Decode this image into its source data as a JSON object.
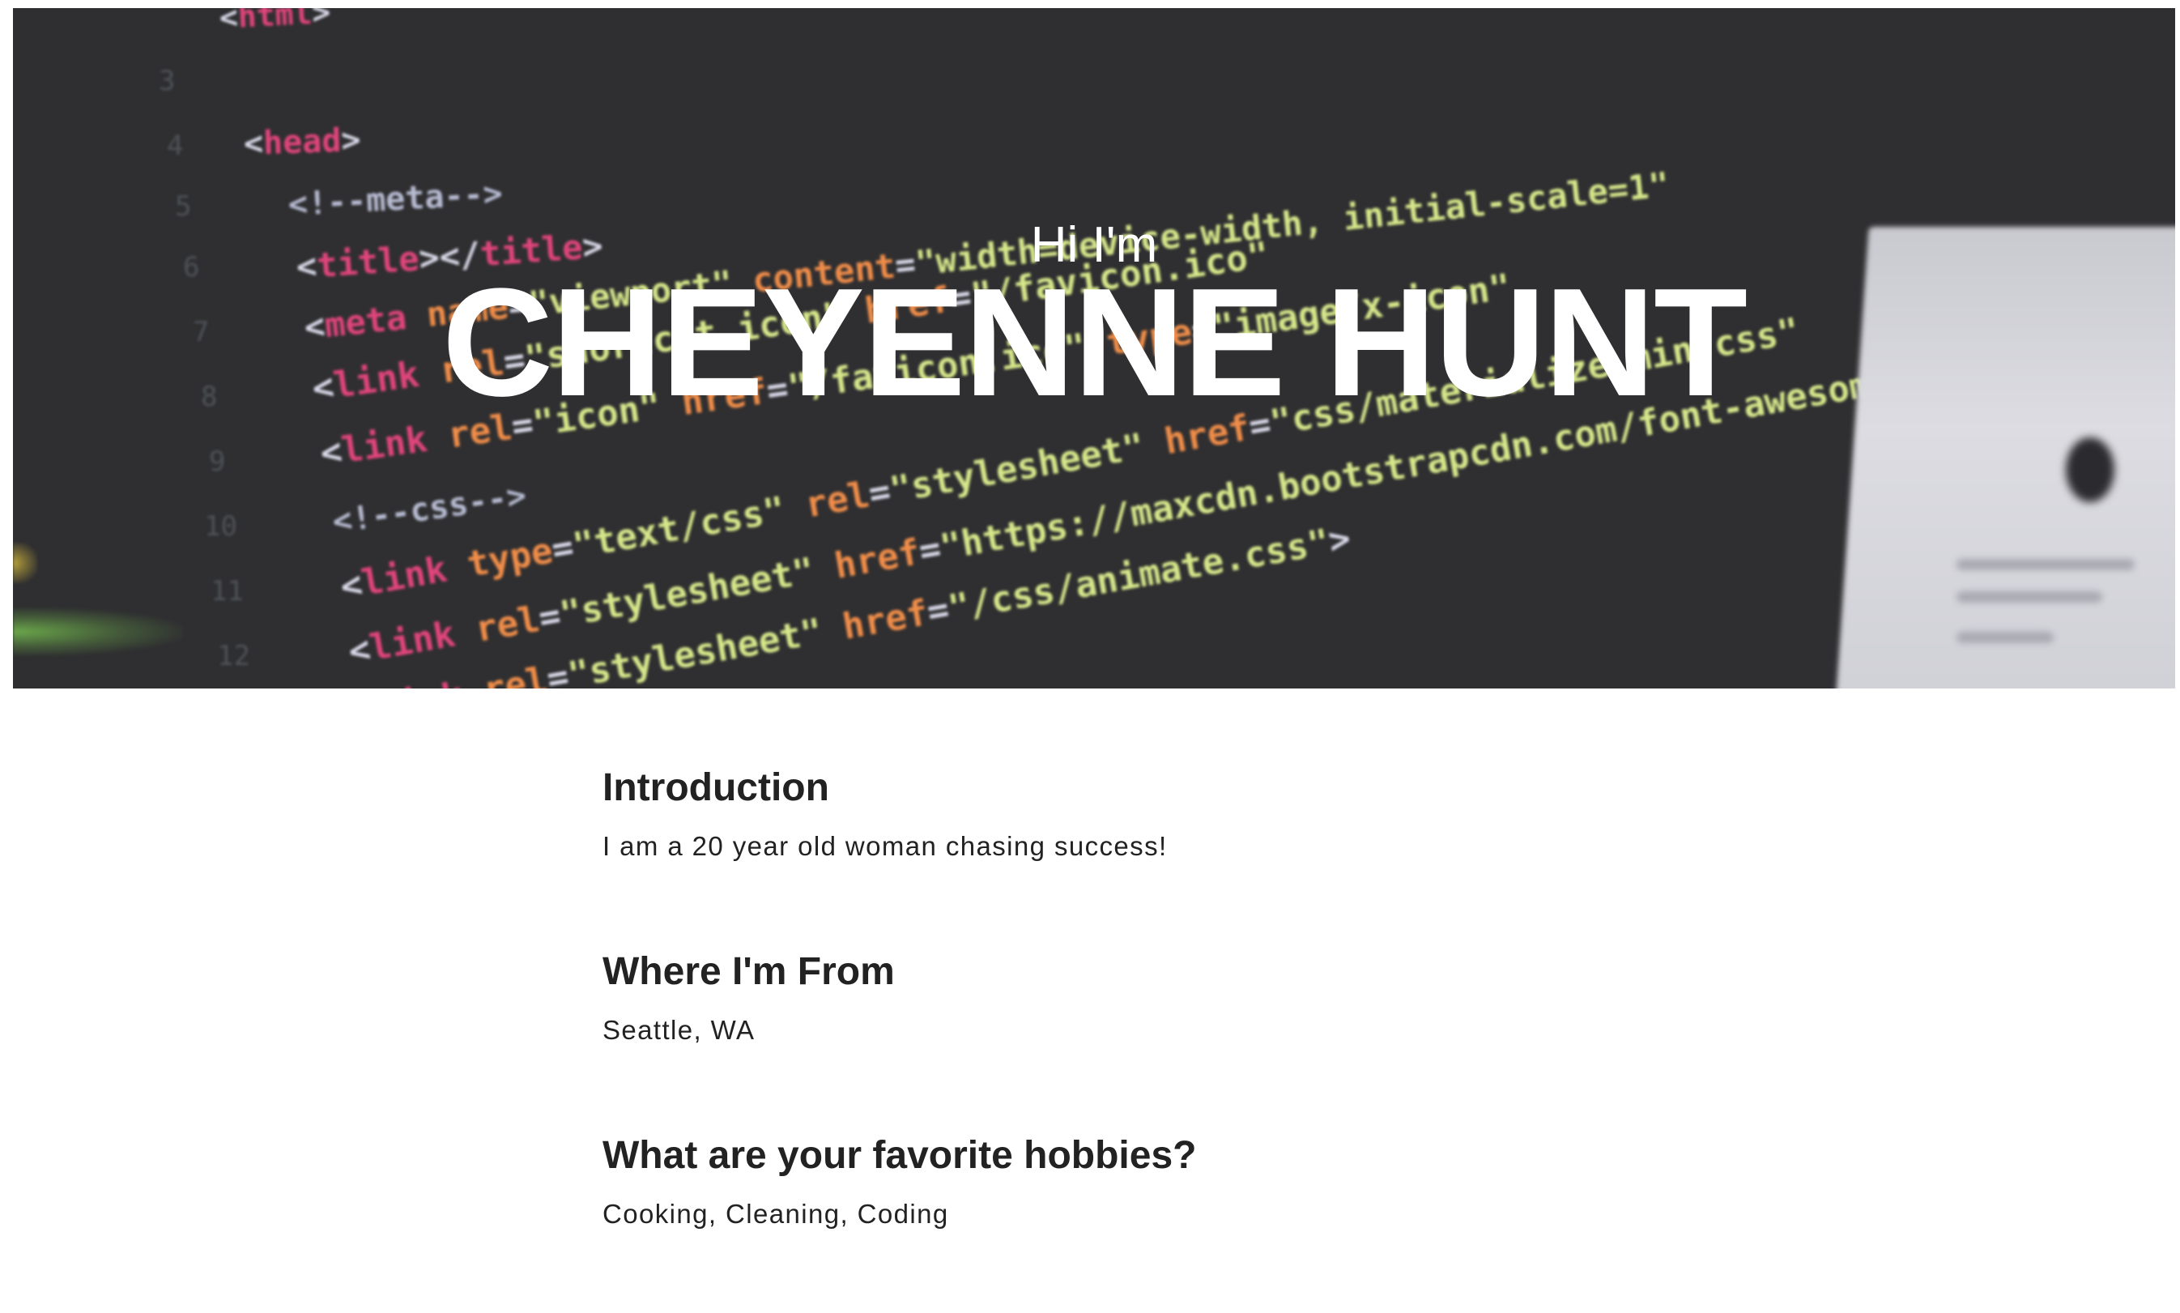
{
  "hero": {
    "greeting": "Hi I'm",
    "name": "CHEYENNE HUNT"
  },
  "sections": [
    {
      "title": "Introduction",
      "text": "I am a 20 year old woman chasing success!"
    },
    {
      "title": "Where I'm From",
      "text": "Seattle, WA"
    },
    {
      "title": "What are your favorite hobbies?",
      "text": "Cooking, Cleaning, Coding"
    }
  ],
  "colors": {
    "hero_background": "#2f2f31",
    "hero_text": "#ffffff",
    "body_text": "#222222"
  }
}
